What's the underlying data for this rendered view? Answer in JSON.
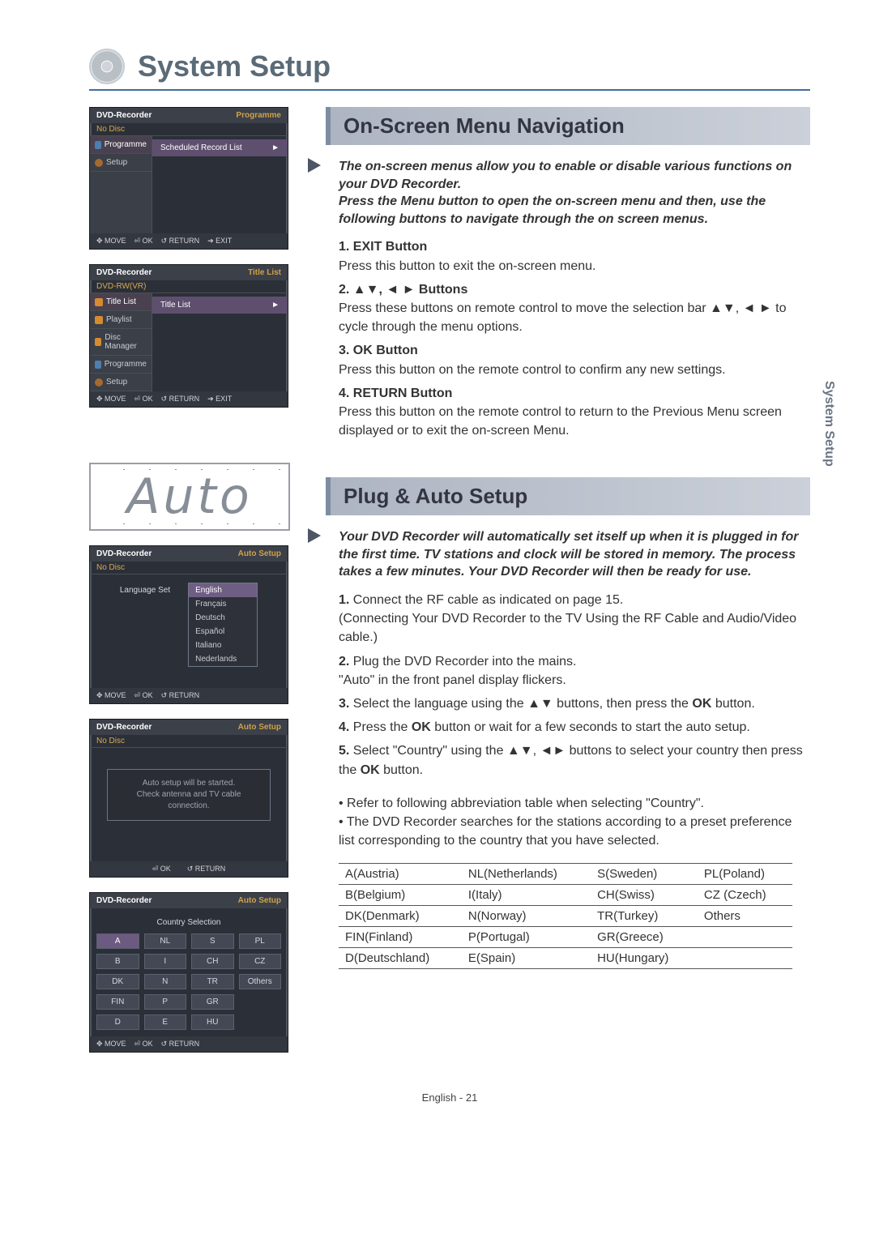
{
  "page_title": "System Setup",
  "side_tab": "System Setup",
  "footer": "English - 21",
  "section1": {
    "heading": "On-Screen Menu Navigation",
    "intro1": "The on-screen menus allow you to enable or disable various functions on your DVD Recorder.",
    "intro2": "Press the Menu button to open the on-screen menu and then, use the following buttons to navigate through the on screen menus.",
    "items": [
      {
        "n": "1.",
        "label": "EXIT Button",
        "body": "Press this button to exit the on-screen menu."
      },
      {
        "n": "2.",
        "label": "▲▼, ◄ ► Buttons",
        "body": "Press these buttons on remote control to move the selection bar ▲▼, ◄ ► to cycle through the menu options."
      },
      {
        "n": "3.",
        "label": "OK Button",
        "body": "Press this button on the remote control to confirm any new settings."
      },
      {
        "n": "4.",
        "label": "RETURN Button",
        "body": "Press this button on the remote control to return to the Previous Menu screen displayed or to exit the on-screen Menu."
      }
    ]
  },
  "section2": {
    "heading": "Plug & Auto Setup",
    "intro": "Your DVD Recorder will automatically set itself up when it is plugged in for the first time. TV stations and clock will be stored in memory. The process takes a few minutes. Your DVD Recorder will then be ready for use.",
    "items": [
      {
        "n": "1.",
        "body": "Connect the RF cable as indicated on page 15.\n(Connecting Your DVD Recorder to the TV Using the RF Cable and Audio/Video cable.)"
      },
      {
        "n": "2.",
        "body": "Plug the DVD Recorder into the mains.\n\"Auto\" in the front panel display flickers."
      },
      {
        "n": "3.",
        "body": "Select the language using the ▲▼ buttons, then press the OK button."
      },
      {
        "n": "4.",
        "body": "Press the OK button or wait for a few seconds to start the auto setup."
      },
      {
        "n": "5.",
        "body": "Select \"Country\" using the ▲▼, ◄► buttons to select your country then press the OK button."
      }
    ],
    "sub_bullets": [
      "Refer to following abbreviation table when selecting \"Country\".",
      "The DVD Recorder searches for the stations according to a preset preference list corresponding to the country that you have selected."
    ],
    "table": [
      [
        "A(Austria)",
        "NL(Netherlands)",
        "S(Sweden)",
        "PL(Poland)"
      ],
      [
        "B(Belgium)",
        "I(Italy)",
        "CH(Swiss)",
        "CZ (Czech)"
      ],
      [
        "DK(Denmark)",
        "N(Norway)",
        "TR(Turkey)",
        "Others"
      ],
      [
        "FIN(Finland)",
        "P(Portugal)",
        "GR(Greece)",
        ""
      ],
      [
        "D(Deutschland)",
        "E(Spain)",
        "HU(Hungary)",
        ""
      ]
    ]
  },
  "osd1": {
    "title_l": "DVD-Recorder",
    "title_r": "Programme",
    "sub": "No Disc",
    "side": [
      "Programme",
      "Setup"
    ],
    "main_row": "Scheduled Record List",
    "footer": [
      "✥ MOVE",
      "⏎ OK",
      "↺ RETURN",
      "➔ EXIT"
    ]
  },
  "osd2": {
    "title_l": "DVD-Recorder",
    "title_r": "Title List",
    "sub": "DVD-RW(VR)",
    "side": [
      "Title List",
      "Playlist",
      "Disc Manager",
      "Programme",
      "Setup"
    ],
    "main_row": "Title List",
    "footer": [
      "✥ MOVE",
      "⏎ OK",
      "↺ RETURN",
      "➔ EXIT"
    ]
  },
  "seg_text": "Auto",
  "osd3": {
    "title_l": "DVD-Recorder",
    "title_r": "Auto Setup",
    "sub": "No Disc",
    "label": "Language Set",
    "langs": [
      "English",
      "Français",
      "Deutsch",
      "Español",
      "Italiano",
      "Nederlands"
    ],
    "footer": [
      "✥ MOVE",
      "⏎ OK",
      "↺ RETURN"
    ]
  },
  "osd4": {
    "title_l": "DVD-Recorder",
    "title_r": "Auto Setup",
    "sub": "No Disc",
    "msg1": "Auto setup will be started.",
    "msg2": "Check antenna and TV cable connection.",
    "footer": [
      "⏎ OK",
      "↺ RETURN"
    ]
  },
  "osd5": {
    "title_l": "DVD-Recorder",
    "title_r": "Auto Setup",
    "head": "Country Selection",
    "grid": [
      "A",
      "NL",
      "S",
      "PL",
      "B",
      "I",
      "CH",
      "CZ",
      "DK",
      "N",
      "TR",
      "Others",
      "FIN",
      "P",
      "GR",
      "",
      "D",
      "E",
      "HU",
      ""
    ],
    "footer": [
      "✥ MOVE",
      "⏎ OK",
      "↺ RETURN"
    ]
  }
}
